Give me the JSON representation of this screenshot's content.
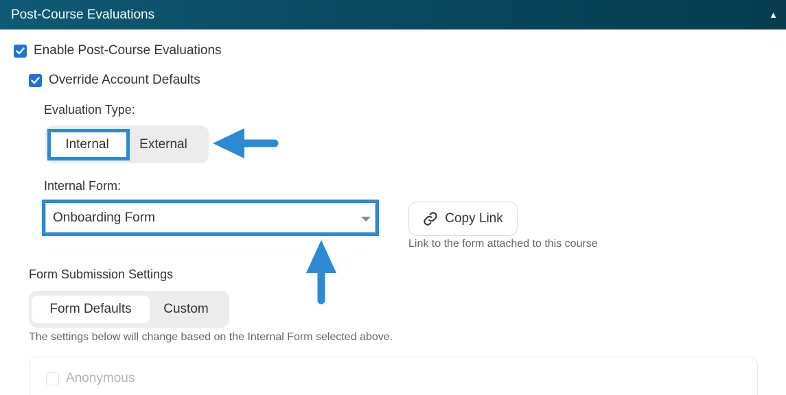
{
  "header": {
    "title": "Post-Course Evaluations",
    "collapse_icon": "triangle-up-icon"
  },
  "enable_checkbox": {
    "label": "Enable Post-Course Evaluations",
    "checked": true
  },
  "override_checkbox": {
    "label": "Override Account Defaults",
    "checked": true
  },
  "evaluation_type": {
    "label": "Evaluation Type:",
    "options": [
      "Internal",
      "External"
    ],
    "selected": "Internal"
  },
  "internal_form": {
    "label": "Internal Form:",
    "value": "Onboarding Form"
  },
  "copy_link": {
    "label": "Copy Link",
    "icon": "link-icon",
    "help": "Link to the form attached to this course"
  },
  "submission_settings": {
    "label": "Form Submission Settings",
    "options": [
      "Form Defaults",
      "Custom"
    ],
    "selected": "Form Defaults",
    "help": "The settings below will change based on the Internal Form selected above."
  },
  "anonymous_checkbox": {
    "label": "Anonymous",
    "checked": false,
    "disabled": true
  },
  "colors": {
    "header": "#0a4b62",
    "checkbox": "#1f73d6",
    "annotation": "#2b8ad3"
  }
}
